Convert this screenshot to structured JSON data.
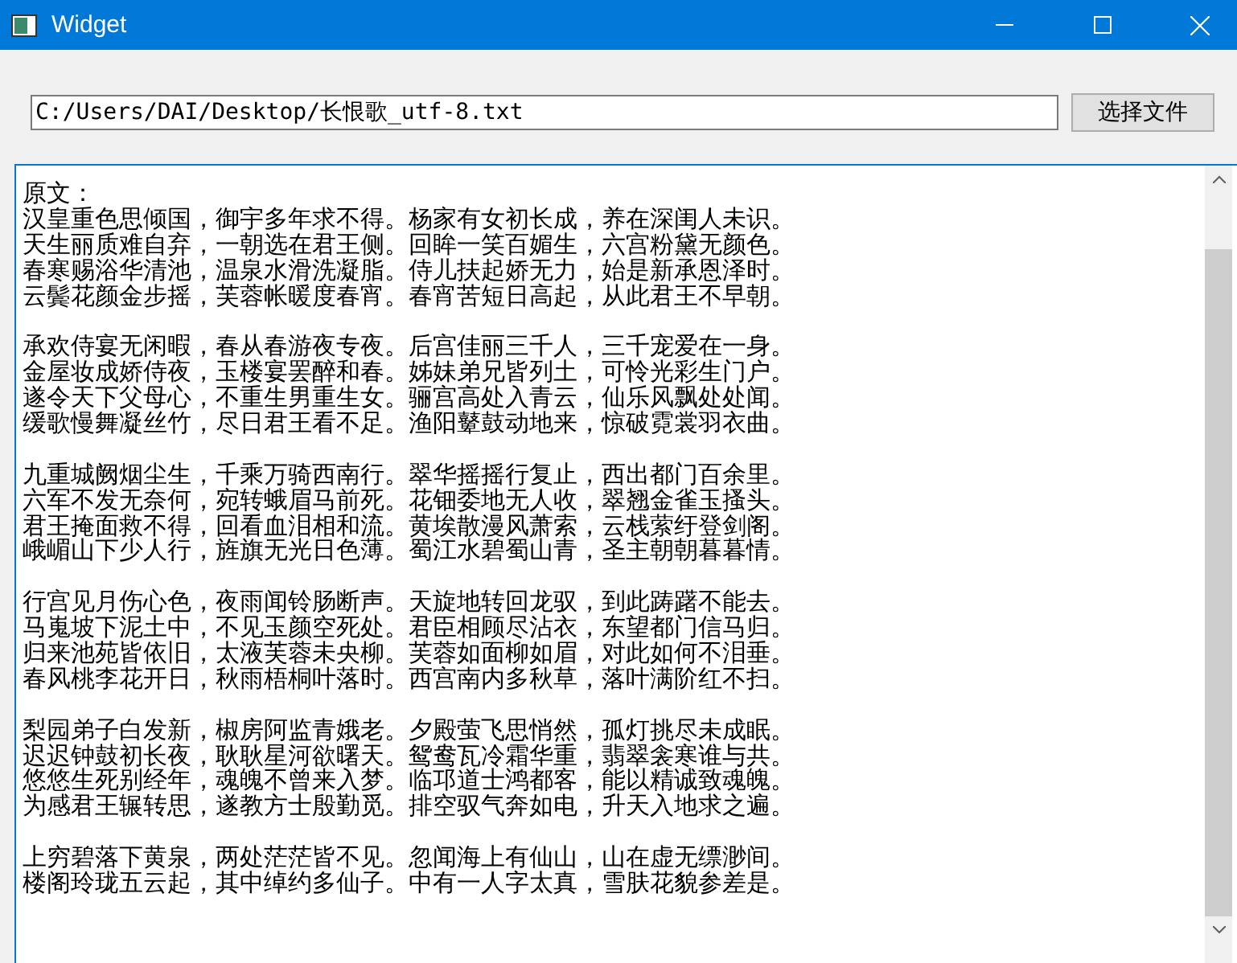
{
  "window": {
    "title": "Widget"
  },
  "path_field": {
    "value": "C:/Users/DAI/Desktop/长恨歌_utf-8.txt"
  },
  "browse_button": {
    "label": "选择文件"
  },
  "text_area": {
    "heading": "原文：",
    "stanzas": [
      [
        "汉皇重色思倾国，御宇多年求不得。杨家有女初长成，养在深闺人未识。",
        "天生丽质难自弃，一朝选在君王侧。回眸一笑百媚生，六宫粉黛无颜色。",
        "春寒赐浴华清池，温泉水滑洗凝脂。侍儿扶起娇无力，始是新承恩泽时。",
        "云鬓花颜金步摇，芙蓉帐暖度春宵。春宵苦短日高起，从此君王不早朝。"
      ],
      [
        "承欢侍宴无闲暇，春从春游夜专夜。后宫佳丽三千人，三千宠爱在一身。",
        "金屋妆成娇侍夜，玉楼宴罢醉和春。姊妹弟兄皆列土，可怜光彩生门户。",
        "遂令天下父母心，不重生男重生女。骊宫高处入青云，仙乐风飘处处闻。",
        "缓歌慢舞凝丝竹，尽日君王看不足。渔阳鼙鼓动地来，惊破霓裳羽衣曲。"
      ],
      [
        "九重城阙烟尘生，千乘万骑西南行。翠华摇摇行复止，西出都门百余里。",
        "六军不发无奈何，宛转蛾眉马前死。花钿委地无人收，翠翘金雀玉搔头。",
        "君王掩面救不得，回看血泪相和流。黄埃散漫风萧索，云栈萦纡登剑阁。",
        "峨嵋山下少人行，旌旗无光日色薄。蜀江水碧蜀山青，圣主朝朝暮暮情。"
      ],
      [
        "行宫见月伤心色，夜雨闻铃肠断声。天旋地转回龙驭，到此踌躇不能去。",
        "马嵬坡下泥土中，不见玉颜空死处。君臣相顾尽沾衣，东望都门信马归。",
        "归来池苑皆依旧，太液芙蓉未央柳。芙蓉如面柳如眉，对此如何不泪垂。",
        "春风桃李花开日，秋雨梧桐叶落时。西宫南内多秋草，落叶满阶红不扫。"
      ],
      [
        "梨园弟子白发新，椒房阿监青娥老。夕殿萤飞思悄然，孤灯挑尽未成眠。",
        "迟迟钟鼓初长夜，耿耿星河欲曙天。鸳鸯瓦冷霜华重，翡翠衾寒谁与共。",
        "悠悠生死别经年，魂魄不曾来入梦。临邛道士鸿都客，能以精诚致魂魄。",
        "为感君王辗转思，遂教方士殷勤觅。排空驭气奔如电，升天入地求之遍。"
      ],
      [
        "上穷碧落下黄泉，两处茫茫皆不见。忽闻海上有仙山，山在虚无缥渺间。",
        "楼阁玲珑五云起，其中绰约多仙子。中有一人字太真，雪肤花貌参差是。"
      ]
    ]
  }
}
